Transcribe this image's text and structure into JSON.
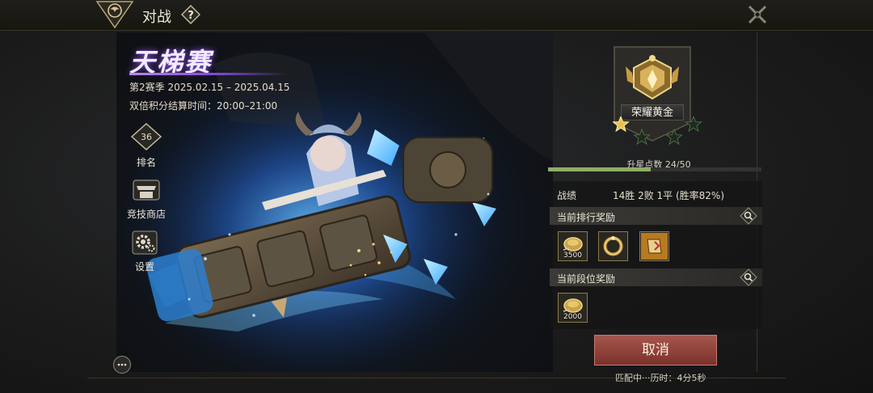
{
  "header": {
    "title": "对战",
    "help_glyph": "?"
  },
  "ladder": {
    "title": "天梯赛",
    "season": "第2赛季 2025.02.15 – 2025.04.15",
    "double_points_time": "双倍积分结算时间：20:00–21:00"
  },
  "sidebar": {
    "rank_number": "36",
    "rank_label": "排名",
    "shop_label": "竞技商店",
    "settings_label": "设置"
  },
  "rank": {
    "tier_name": "荣耀黄金",
    "stars_filled": 1,
    "stars_total": 4,
    "star_points_text": "升星点数 24/50",
    "star_points_current": 24,
    "star_points_max": 50
  },
  "record": {
    "label": "战绩",
    "value": "14胜  2败  1平  (胜率82%)"
  },
  "rank_rewards": {
    "label": "当前排行奖励",
    "items": [
      {
        "icon": "gold-coin-icon",
        "qty": "3500"
      },
      {
        "icon": "ring-icon",
        "qty": ""
      },
      {
        "icon": "scroll-icon",
        "qty": ""
      }
    ]
  },
  "tier_rewards": {
    "label": "当前段位奖励",
    "items": [
      {
        "icon": "gold-coin-icon",
        "qty": "2000"
      }
    ]
  },
  "actions": {
    "cancel_label": "取消",
    "match_status": "匹配中···历时：4分5秒"
  },
  "colors": {
    "accent_purple": "#8a55e0",
    "progress_green": "#8fae66",
    "cancel_red": "#8e4038",
    "gold": "#c9a24a"
  }
}
